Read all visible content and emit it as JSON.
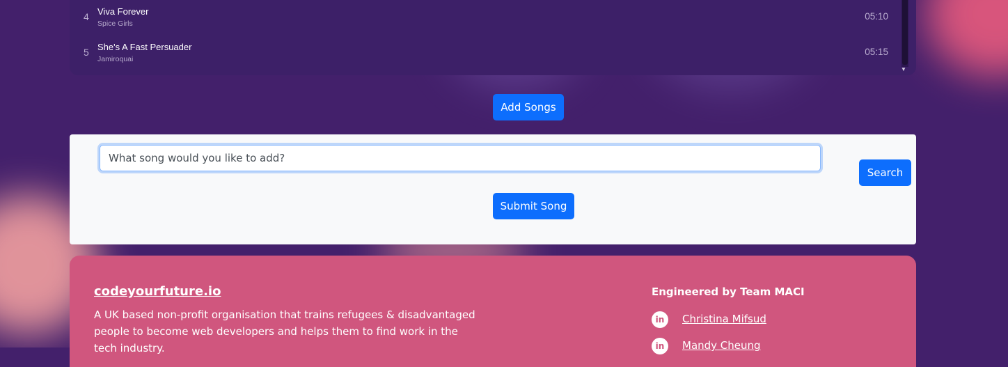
{
  "tracks": [
    {
      "number": "4",
      "title": "Viva Forever",
      "artist": "Spice Girls",
      "duration": "05:10"
    },
    {
      "number": "5",
      "title": "She's A Fast Persuader",
      "artist": "Jamiroquai",
      "duration": "05:15"
    }
  ],
  "actions": {
    "add_songs_label": "Add Songs",
    "search_label": "Search",
    "submit_label": "Submit Song"
  },
  "song_form": {
    "placeholder": "What song would you like to add?",
    "value": ""
  },
  "footer": {
    "brand": "codeyourfuture.io",
    "description": "A UK based non-profit organisation that trains refugees & disadvantaged people to become web developers and helps them to find work in the tech industry.",
    "engineered_by": "Engineered by Team MACI",
    "members": [
      {
        "name": "Christina Mifsud",
        "icon": "linkedin-icon"
      },
      {
        "name": "Mandy Cheung",
        "icon": "linkedin-icon"
      }
    ]
  },
  "colors": {
    "background": "#43206b",
    "primary_button": "#0d6efd",
    "footer": "#d0567e",
    "panel": "#f8f9fa"
  }
}
